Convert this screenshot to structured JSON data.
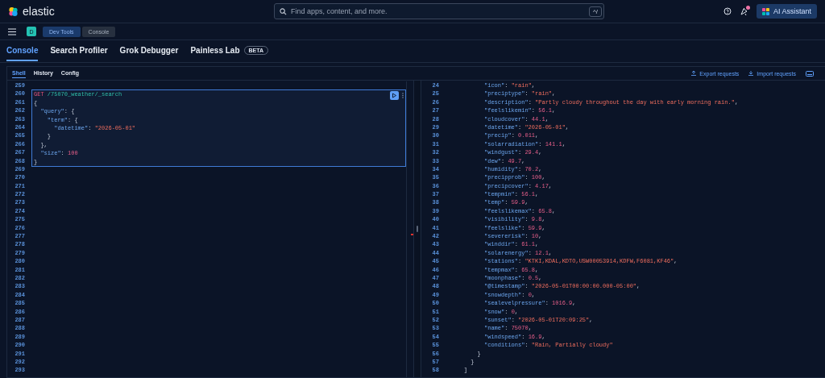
{
  "header": {
    "logo": "elastic",
    "search": {
      "placeholder": "Find apps, content, and more.",
      "shortcut": "^/"
    },
    "has_unread": true,
    "ai_button": "AI Assistant"
  },
  "breadcrumbs": {
    "avatar": "D",
    "items": [
      "Dev Tools",
      "Console"
    ]
  },
  "tabs": [
    {
      "label": "Console",
      "selected": true
    },
    {
      "label": "Search Profiler",
      "selected": false
    },
    {
      "label": "Grok Debugger",
      "selected": false
    },
    {
      "label": "Painless Lab",
      "selected": false,
      "badge": "BETA"
    }
  ],
  "console": {
    "tabs": [
      {
        "label": "Shell",
        "selected": true
      },
      {
        "label": "History",
        "selected": false
      },
      {
        "label": "Config",
        "selected": false
      }
    ],
    "actions": [
      "Export requests",
      "Import requests"
    ]
  },
  "request_editor": {
    "lines": [
      {
        "number": "259"
      },
      {
        "number": "260",
        "tokens": [
          {
            "kind": "method",
            "text": "GET"
          },
          {
            "kind": "path",
            "text": " /75070_weather/_search"
          }
        ]
      },
      {
        "number": "261",
        "tokens": [
          {
            "kind": "punct",
            "text": "{"
          }
        ]
      },
      {
        "number": "262",
        "tokens": [
          {
            "kind": "key",
            "text": "  \"query\""
          },
          {
            "kind": "punct",
            "text": ": {"
          }
        ]
      },
      {
        "number": "263",
        "tokens": [
          {
            "kind": "key",
            "text": "    \"term\""
          },
          {
            "kind": "punct",
            "text": ": {"
          }
        ]
      },
      {
        "number": "264",
        "tokens": [
          {
            "kind": "key",
            "text": "      \"datetime\""
          },
          {
            "kind": "punct",
            "text": ": "
          },
          {
            "kind": "string",
            "text": "\"2026-05-01\""
          }
        ]
      },
      {
        "number": "265",
        "tokens": [
          {
            "kind": "punct",
            "text": "    }"
          }
        ]
      },
      {
        "number": "266",
        "tokens": [
          {
            "kind": "punct",
            "text": "  },"
          }
        ]
      },
      {
        "number": "267",
        "tokens": [
          {
            "kind": "key",
            "text": "  \"size\""
          },
          {
            "kind": "punct",
            "text": ": "
          },
          {
            "kind": "number",
            "text": "100"
          }
        ]
      },
      {
        "number": "268",
        "tokens": [
          {
            "kind": "punct",
            "text": "}"
          }
        ]
      },
      {
        "number": "269"
      },
      {
        "number": "270"
      },
      {
        "number": "271"
      },
      {
        "number": "272"
      },
      {
        "number": "273"
      },
      {
        "number": "274"
      },
      {
        "number": "275"
      },
      {
        "number": "276"
      },
      {
        "number": "277"
      },
      {
        "number": "278"
      },
      {
        "number": "279"
      },
      {
        "number": "280"
      },
      {
        "number": "281"
      },
      {
        "number": "282"
      },
      {
        "number": "283"
      },
      {
        "number": "284"
      },
      {
        "number": "285"
      },
      {
        "number": "286"
      },
      {
        "number": "287"
      },
      {
        "number": "288"
      },
      {
        "number": "289"
      },
      {
        "number": "290"
      },
      {
        "number": "291"
      },
      {
        "number": "292"
      },
      {
        "number": "293"
      }
    ]
  },
  "response_viewer": {
    "lines": [
      {
        "number": "24",
        "tokens": [
          {
            "kind": "key",
            "text": "          \"icon\""
          },
          {
            "kind": "punct",
            "text": ": "
          },
          {
            "kind": "string",
            "text": "\"rain\""
          },
          {
            "kind": "punct",
            "text": ","
          }
        ]
      },
      {
        "number": "25",
        "tokens": [
          {
            "kind": "key",
            "text": "          \"preciptype\""
          },
          {
            "kind": "punct",
            "text": ": "
          },
          {
            "kind": "string",
            "text": "\"rain\""
          },
          {
            "kind": "punct",
            "text": ","
          }
        ]
      },
      {
        "number": "26",
        "tokens": [
          {
            "kind": "key",
            "text": "          \"description\""
          },
          {
            "kind": "punct",
            "text": ": "
          },
          {
            "kind": "string",
            "text": "\"Partly cloudy throughout the day with early morning rain.\""
          },
          {
            "kind": "punct",
            "text": ","
          }
        ]
      },
      {
        "number": "27",
        "tokens": [
          {
            "kind": "key",
            "text": "          \"feelslikemin\""
          },
          {
            "kind": "punct",
            "text": ": "
          },
          {
            "kind": "number",
            "text": "56.1"
          },
          {
            "kind": "punct",
            "text": ","
          }
        ]
      },
      {
        "number": "28",
        "tokens": [
          {
            "kind": "key",
            "text": "          \"cloudcover\""
          },
          {
            "kind": "punct",
            "text": ": "
          },
          {
            "kind": "number",
            "text": "44.1"
          },
          {
            "kind": "punct",
            "text": ","
          }
        ]
      },
      {
        "number": "29",
        "tokens": [
          {
            "kind": "key",
            "text": "          \"datetime\""
          },
          {
            "kind": "punct",
            "text": ": "
          },
          {
            "kind": "string",
            "text": "\"2026-05-01\""
          },
          {
            "kind": "punct",
            "text": ","
          }
        ]
      },
      {
        "number": "30",
        "tokens": [
          {
            "kind": "key",
            "text": "          \"precip\""
          },
          {
            "kind": "punct",
            "text": ": "
          },
          {
            "kind": "number",
            "text": "0.011"
          },
          {
            "kind": "punct",
            "text": ","
          }
        ]
      },
      {
        "number": "31",
        "tokens": [
          {
            "kind": "key",
            "text": "          \"solarradiation\""
          },
          {
            "kind": "punct",
            "text": ": "
          },
          {
            "kind": "number",
            "text": "141.1"
          },
          {
            "kind": "punct",
            "text": ","
          }
        ]
      },
      {
        "number": "32",
        "tokens": [
          {
            "kind": "key",
            "text": "          \"windgust\""
          },
          {
            "kind": "punct",
            "text": ": "
          },
          {
            "kind": "number",
            "text": "29.4"
          },
          {
            "kind": "punct",
            "text": ","
          }
        ]
      },
      {
        "number": "33",
        "tokens": [
          {
            "kind": "key",
            "text": "          \"dew\""
          },
          {
            "kind": "punct",
            "text": ": "
          },
          {
            "kind": "number",
            "text": "49.7"
          },
          {
            "kind": "punct",
            "text": ","
          }
        ]
      },
      {
        "number": "34",
        "tokens": [
          {
            "kind": "key",
            "text": "          \"humidity\""
          },
          {
            "kind": "punct",
            "text": ": "
          },
          {
            "kind": "number",
            "text": "70.2"
          },
          {
            "kind": "punct",
            "text": ","
          }
        ]
      },
      {
        "number": "35",
        "tokens": [
          {
            "kind": "key",
            "text": "          \"precipprob\""
          },
          {
            "kind": "punct",
            "text": ": "
          },
          {
            "kind": "number",
            "text": "100"
          },
          {
            "kind": "punct",
            "text": ","
          }
        ]
      },
      {
        "number": "36",
        "tokens": [
          {
            "kind": "key",
            "text": "          \"precipcover\""
          },
          {
            "kind": "punct",
            "text": ": "
          },
          {
            "kind": "number",
            "text": "4.17"
          },
          {
            "kind": "punct",
            "text": ","
          }
        ]
      },
      {
        "number": "37",
        "tokens": [
          {
            "kind": "key",
            "text": "          \"tempmin\""
          },
          {
            "kind": "punct",
            "text": ": "
          },
          {
            "kind": "number",
            "text": "56.1"
          },
          {
            "kind": "punct",
            "text": ","
          }
        ]
      },
      {
        "number": "38",
        "tokens": [
          {
            "kind": "key",
            "text": "          \"temp\""
          },
          {
            "kind": "punct",
            "text": ": "
          },
          {
            "kind": "number",
            "text": "59.9"
          },
          {
            "kind": "punct",
            "text": ","
          }
        ]
      },
      {
        "number": "39",
        "tokens": [
          {
            "kind": "key",
            "text": "          \"feelslikemax\""
          },
          {
            "kind": "punct",
            "text": ": "
          },
          {
            "kind": "number",
            "text": "65.8"
          },
          {
            "kind": "punct",
            "text": ","
          }
        ]
      },
      {
        "number": "40",
        "tokens": [
          {
            "kind": "key",
            "text": "          \"visibility\""
          },
          {
            "kind": "punct",
            "text": ": "
          },
          {
            "kind": "number",
            "text": "9.8"
          },
          {
            "kind": "punct",
            "text": ","
          }
        ]
      },
      {
        "number": "41",
        "tokens": [
          {
            "kind": "key",
            "text": "          \"feelslike\""
          },
          {
            "kind": "punct",
            "text": ": "
          },
          {
            "kind": "number",
            "text": "59.9"
          },
          {
            "kind": "punct",
            "text": ","
          }
        ]
      },
      {
        "number": "42",
        "tokens": [
          {
            "kind": "key",
            "text": "          \"severerisk\""
          },
          {
            "kind": "punct",
            "text": ": "
          },
          {
            "kind": "number",
            "text": "10"
          },
          {
            "kind": "punct",
            "text": ","
          }
        ]
      },
      {
        "number": "43",
        "tokens": [
          {
            "kind": "key",
            "text": "          \"winddir\""
          },
          {
            "kind": "punct",
            "text": ": "
          },
          {
            "kind": "number",
            "text": "61.1"
          },
          {
            "kind": "punct",
            "text": ","
          }
        ]
      },
      {
        "number": "44",
        "tokens": [
          {
            "kind": "key",
            "text": "          \"solarenergy\""
          },
          {
            "kind": "punct",
            "text": ": "
          },
          {
            "kind": "number",
            "text": "12.1"
          },
          {
            "kind": "punct",
            "text": ","
          }
        ]
      },
      {
        "number": "45",
        "tokens": [
          {
            "kind": "key",
            "text": "          \"stations\""
          },
          {
            "kind": "punct",
            "text": ": "
          },
          {
            "kind": "string",
            "text": "\"KTKI,KDAL,KDTO,USW00053914,KDFW,F6081,KF46\""
          },
          {
            "kind": "punct",
            "text": ","
          }
        ]
      },
      {
        "number": "46",
        "tokens": [
          {
            "kind": "key",
            "text": "          \"tempmax\""
          },
          {
            "kind": "punct",
            "text": ": "
          },
          {
            "kind": "number",
            "text": "65.8"
          },
          {
            "kind": "punct",
            "text": ","
          }
        ]
      },
      {
        "number": "47",
        "tokens": [
          {
            "kind": "key",
            "text": "          \"moonphase\""
          },
          {
            "kind": "punct",
            "text": ": "
          },
          {
            "kind": "number",
            "text": "0.5"
          },
          {
            "kind": "punct",
            "text": ","
          }
        ]
      },
      {
        "number": "48",
        "tokens": [
          {
            "kind": "key",
            "text": "          \"@timestamp\""
          },
          {
            "kind": "punct",
            "text": ": "
          },
          {
            "kind": "string",
            "text": "\"2026-05-01T00:00:00.000-05:00\""
          },
          {
            "kind": "punct",
            "text": ","
          }
        ]
      },
      {
        "number": "49",
        "tokens": [
          {
            "kind": "key",
            "text": "          \"snowdepth\""
          },
          {
            "kind": "punct",
            "text": ": "
          },
          {
            "kind": "number",
            "text": "0"
          },
          {
            "kind": "punct",
            "text": ","
          }
        ]
      },
      {
        "number": "50",
        "tokens": [
          {
            "kind": "key",
            "text": "          \"sealevelpressure\""
          },
          {
            "kind": "punct",
            "text": ": "
          },
          {
            "kind": "number",
            "text": "1016.9"
          },
          {
            "kind": "punct",
            "text": ","
          }
        ]
      },
      {
        "number": "51",
        "tokens": [
          {
            "kind": "key",
            "text": "          \"snow\""
          },
          {
            "kind": "punct",
            "text": ": "
          },
          {
            "kind": "number",
            "text": "0"
          },
          {
            "kind": "punct",
            "text": ","
          }
        ]
      },
      {
        "number": "52",
        "tokens": [
          {
            "kind": "key",
            "text": "          \"sunset\""
          },
          {
            "kind": "punct",
            "text": ": "
          },
          {
            "kind": "string",
            "text": "\"2026-05-01T20:09:25\""
          },
          {
            "kind": "punct",
            "text": ","
          }
        ]
      },
      {
        "number": "53",
        "tokens": [
          {
            "kind": "key",
            "text": "          \"name\""
          },
          {
            "kind": "punct",
            "text": ": "
          },
          {
            "kind": "number",
            "text": "75070"
          },
          {
            "kind": "punct",
            "text": ","
          }
        ]
      },
      {
        "number": "54",
        "tokens": [
          {
            "kind": "key",
            "text": "          \"windspeed\""
          },
          {
            "kind": "punct",
            "text": ": "
          },
          {
            "kind": "number",
            "text": "16.9"
          },
          {
            "kind": "punct",
            "text": ","
          }
        ]
      },
      {
        "number": "55",
        "tokens": [
          {
            "kind": "key",
            "text": "          \"conditions\""
          },
          {
            "kind": "punct",
            "text": ": "
          },
          {
            "kind": "string",
            "text": "\"Rain, Partially cloudy\""
          }
        ]
      },
      {
        "number": "56",
        "tokens": [
          {
            "kind": "punct",
            "text": "        }"
          }
        ]
      },
      {
        "number": "57",
        "tokens": [
          {
            "kind": "punct",
            "text": "      }"
          }
        ]
      },
      {
        "number": "58",
        "tokens": [
          {
            "kind": "punct",
            "text": "    ]"
          }
        ]
      }
    ]
  }
}
